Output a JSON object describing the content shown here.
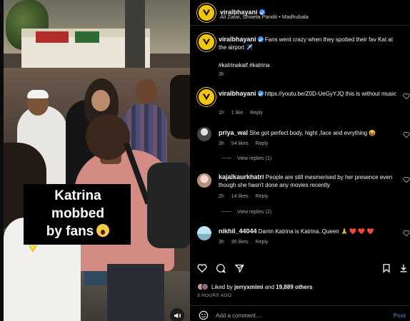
{
  "post": {
    "video_caption_line1": "Katrina mobbed",
    "video_caption_line2": "by fans"
  },
  "header": {
    "username": "viralbhayani",
    "subtitle": "Ali Zafar, Shweta Pandit • Madhubala",
    "more_icon": "more-horizontal-icon"
  },
  "caption": {
    "username": "viralbhayani",
    "text": "Fans went crazy when they spotted their fav Kat at the airport ✈️",
    "hashtags": "#katrinakaif #katrina",
    "time": "3h"
  },
  "comments": [
    {
      "username": "viralbhayani",
      "text": "https://youtu.be/Z0D-UeGyYJQ this is without music",
      "time": "1h",
      "likes": "1 like",
      "reply": "Reply"
    },
    {
      "username": "priya_wal",
      "text": "She got perfect body, hight ,face and evrything 😝",
      "time": "3h",
      "likes": "54 likes",
      "reply": "Reply",
      "view_replies": "View replies (1)"
    },
    {
      "username": "kajalkaurkhatri",
      "text": "People are still mesmerised by her presence even though she hasn't done any movies recently",
      "time": "2h",
      "likes": "14 likes",
      "reply": "Reply",
      "view_replies": "View replies (2)"
    },
    {
      "username": "nikhil_44044",
      "text": "Damn Katrina is Katrina..Queen 🙏 ❤️ ❤️ ❤️",
      "time": "3h",
      "likes": "36 likes",
      "reply": "Reply"
    }
  ],
  "likes_line": {
    "prefix": "Liked by ",
    "user": "jerryxmimi",
    "middle": " and ",
    "count": "19,889 others"
  },
  "posted_ago": "3 HOURS AGO",
  "comment_box": {
    "placeholder": "Add a comment…",
    "post_label": "Post"
  },
  "colors": {
    "brand_yellow": "#f2c50f",
    "verified_blue": "#3897f0",
    "background": "#000000",
    "muted_text": "#a8a8a8"
  }
}
